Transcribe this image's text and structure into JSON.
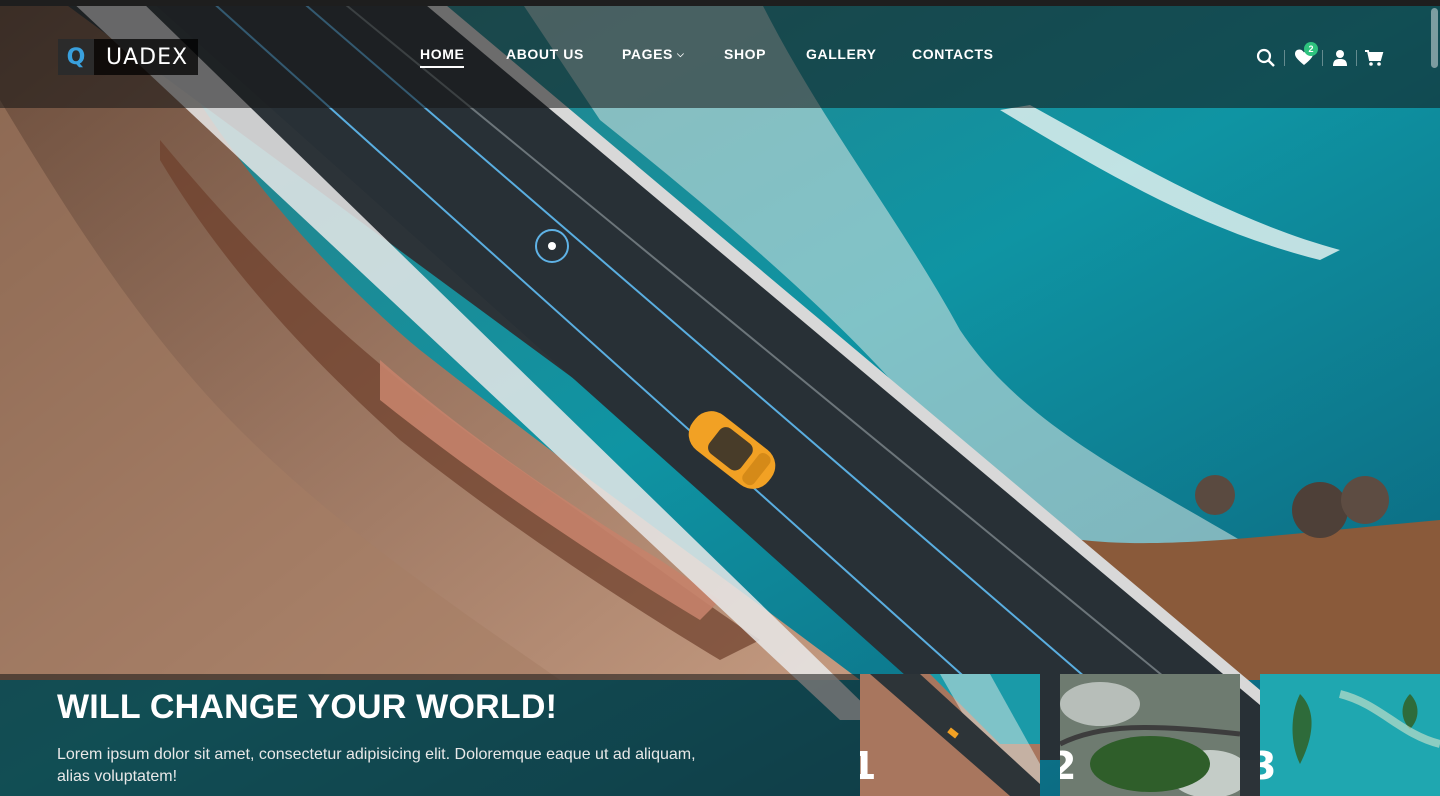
{
  "brand": {
    "logo_letter": "Q",
    "logo_text": "UADEX",
    "accent": "#39a0dd"
  },
  "nav": {
    "items": [
      {
        "label": "HOME",
        "active": true
      },
      {
        "label": "ABOUT US",
        "active": false
      },
      {
        "label": "PAGES",
        "active": false,
        "has_dropdown": true
      },
      {
        "label": "SHOP",
        "active": false
      },
      {
        "label": "GALLERY",
        "active": false
      },
      {
        "label": "CONTACTS",
        "active": false
      }
    ]
  },
  "header_icons": {
    "search": "search-icon",
    "wishlist": "heart-icon",
    "wishlist_count": "2",
    "account": "user-icon",
    "cart": "cart-icon",
    "badge_color": "#2ec27e"
  },
  "slide": {
    "title": "WILL CHANGE YOUR WORLD!",
    "text": "Lorem ipsum dolor sit amet, consectetur adipisicing elit. Doloremque eaque ut ad aliquam, alias voluptatem!"
  },
  "thumbnails": [
    {
      "number": "1",
      "active": true
    },
    {
      "number": "2",
      "active": false
    },
    {
      "number": "3",
      "active": false
    }
  ]
}
